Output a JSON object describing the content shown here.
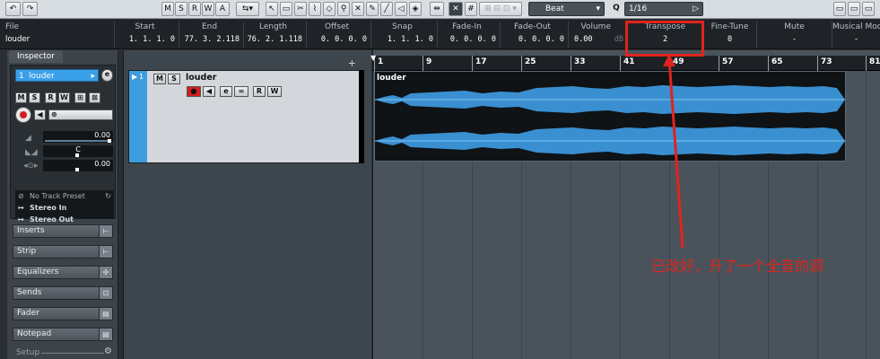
{
  "toolbar": {
    "undo": "↶",
    "redo": "↷",
    "mode_buttons": [
      "M",
      "S",
      "R",
      "W",
      "A"
    ],
    "grid_type": "Beat",
    "quantize_label": "Q",
    "quantize_value": "1/16"
  },
  "infoline": {
    "columns": [
      {
        "label": "File",
        "value": "louder"
      },
      {
        "label": "Start",
        "value": "1. 1. 1.  0"
      },
      {
        "label": "End",
        "value": "77. 3. 2.118"
      },
      {
        "label": "Length",
        "value": "76. 2. 1.118"
      },
      {
        "label": "Offset",
        "value": "0. 0. 0.  0"
      },
      {
        "label": "Snap",
        "value": "1. 1. 1.  0"
      },
      {
        "label": "Fade-In",
        "value": "0. 0. 0.  0"
      },
      {
        "label": "Fade-Out",
        "value": "0. 0. 0.  0"
      },
      {
        "label": "Volume",
        "value": "0.00"
      },
      {
        "label": "Transpose",
        "value": "2"
      },
      {
        "label": "Fine-Tune",
        "value": "0"
      },
      {
        "label": "Mute",
        "value": "-"
      },
      {
        "label": "Musical Mod",
        "value": "-"
      }
    ],
    "volume_unit": "dB"
  },
  "inspector": {
    "tab": "Inspector",
    "track_number": "1",
    "track_name": "louder",
    "buttons": [
      "M",
      "S",
      "R",
      "W"
    ],
    "volume_value": "0.00",
    "pan_value": "C",
    "delay_value": "0.00",
    "preset": "No Track Preset",
    "input": "Stereo In",
    "output": "Stereo Out",
    "sections": [
      "Inserts",
      "Strip",
      "Equalizers",
      "Sends",
      "Fader",
      "Notepad",
      "Setup"
    ]
  },
  "tracklist": {
    "add_symbol": "+",
    "track_number": "1",
    "track_name": "louder",
    "buttons": [
      "M",
      "S"
    ],
    "row2_buttons": [
      "R",
      "W"
    ]
  },
  "ruler": {
    "bars": [
      "1",
      "9",
      "17",
      "25",
      "33",
      "41",
      "49",
      "57",
      "65",
      "73",
      "81"
    ]
  },
  "event": {
    "name": "louder"
  },
  "annotation": "已改好，升了一个全音的调",
  "colors": {
    "accent_blue": "#3aa0e8",
    "waveform": "#3a8fd0",
    "highlight_red": "#e0241d"
  }
}
